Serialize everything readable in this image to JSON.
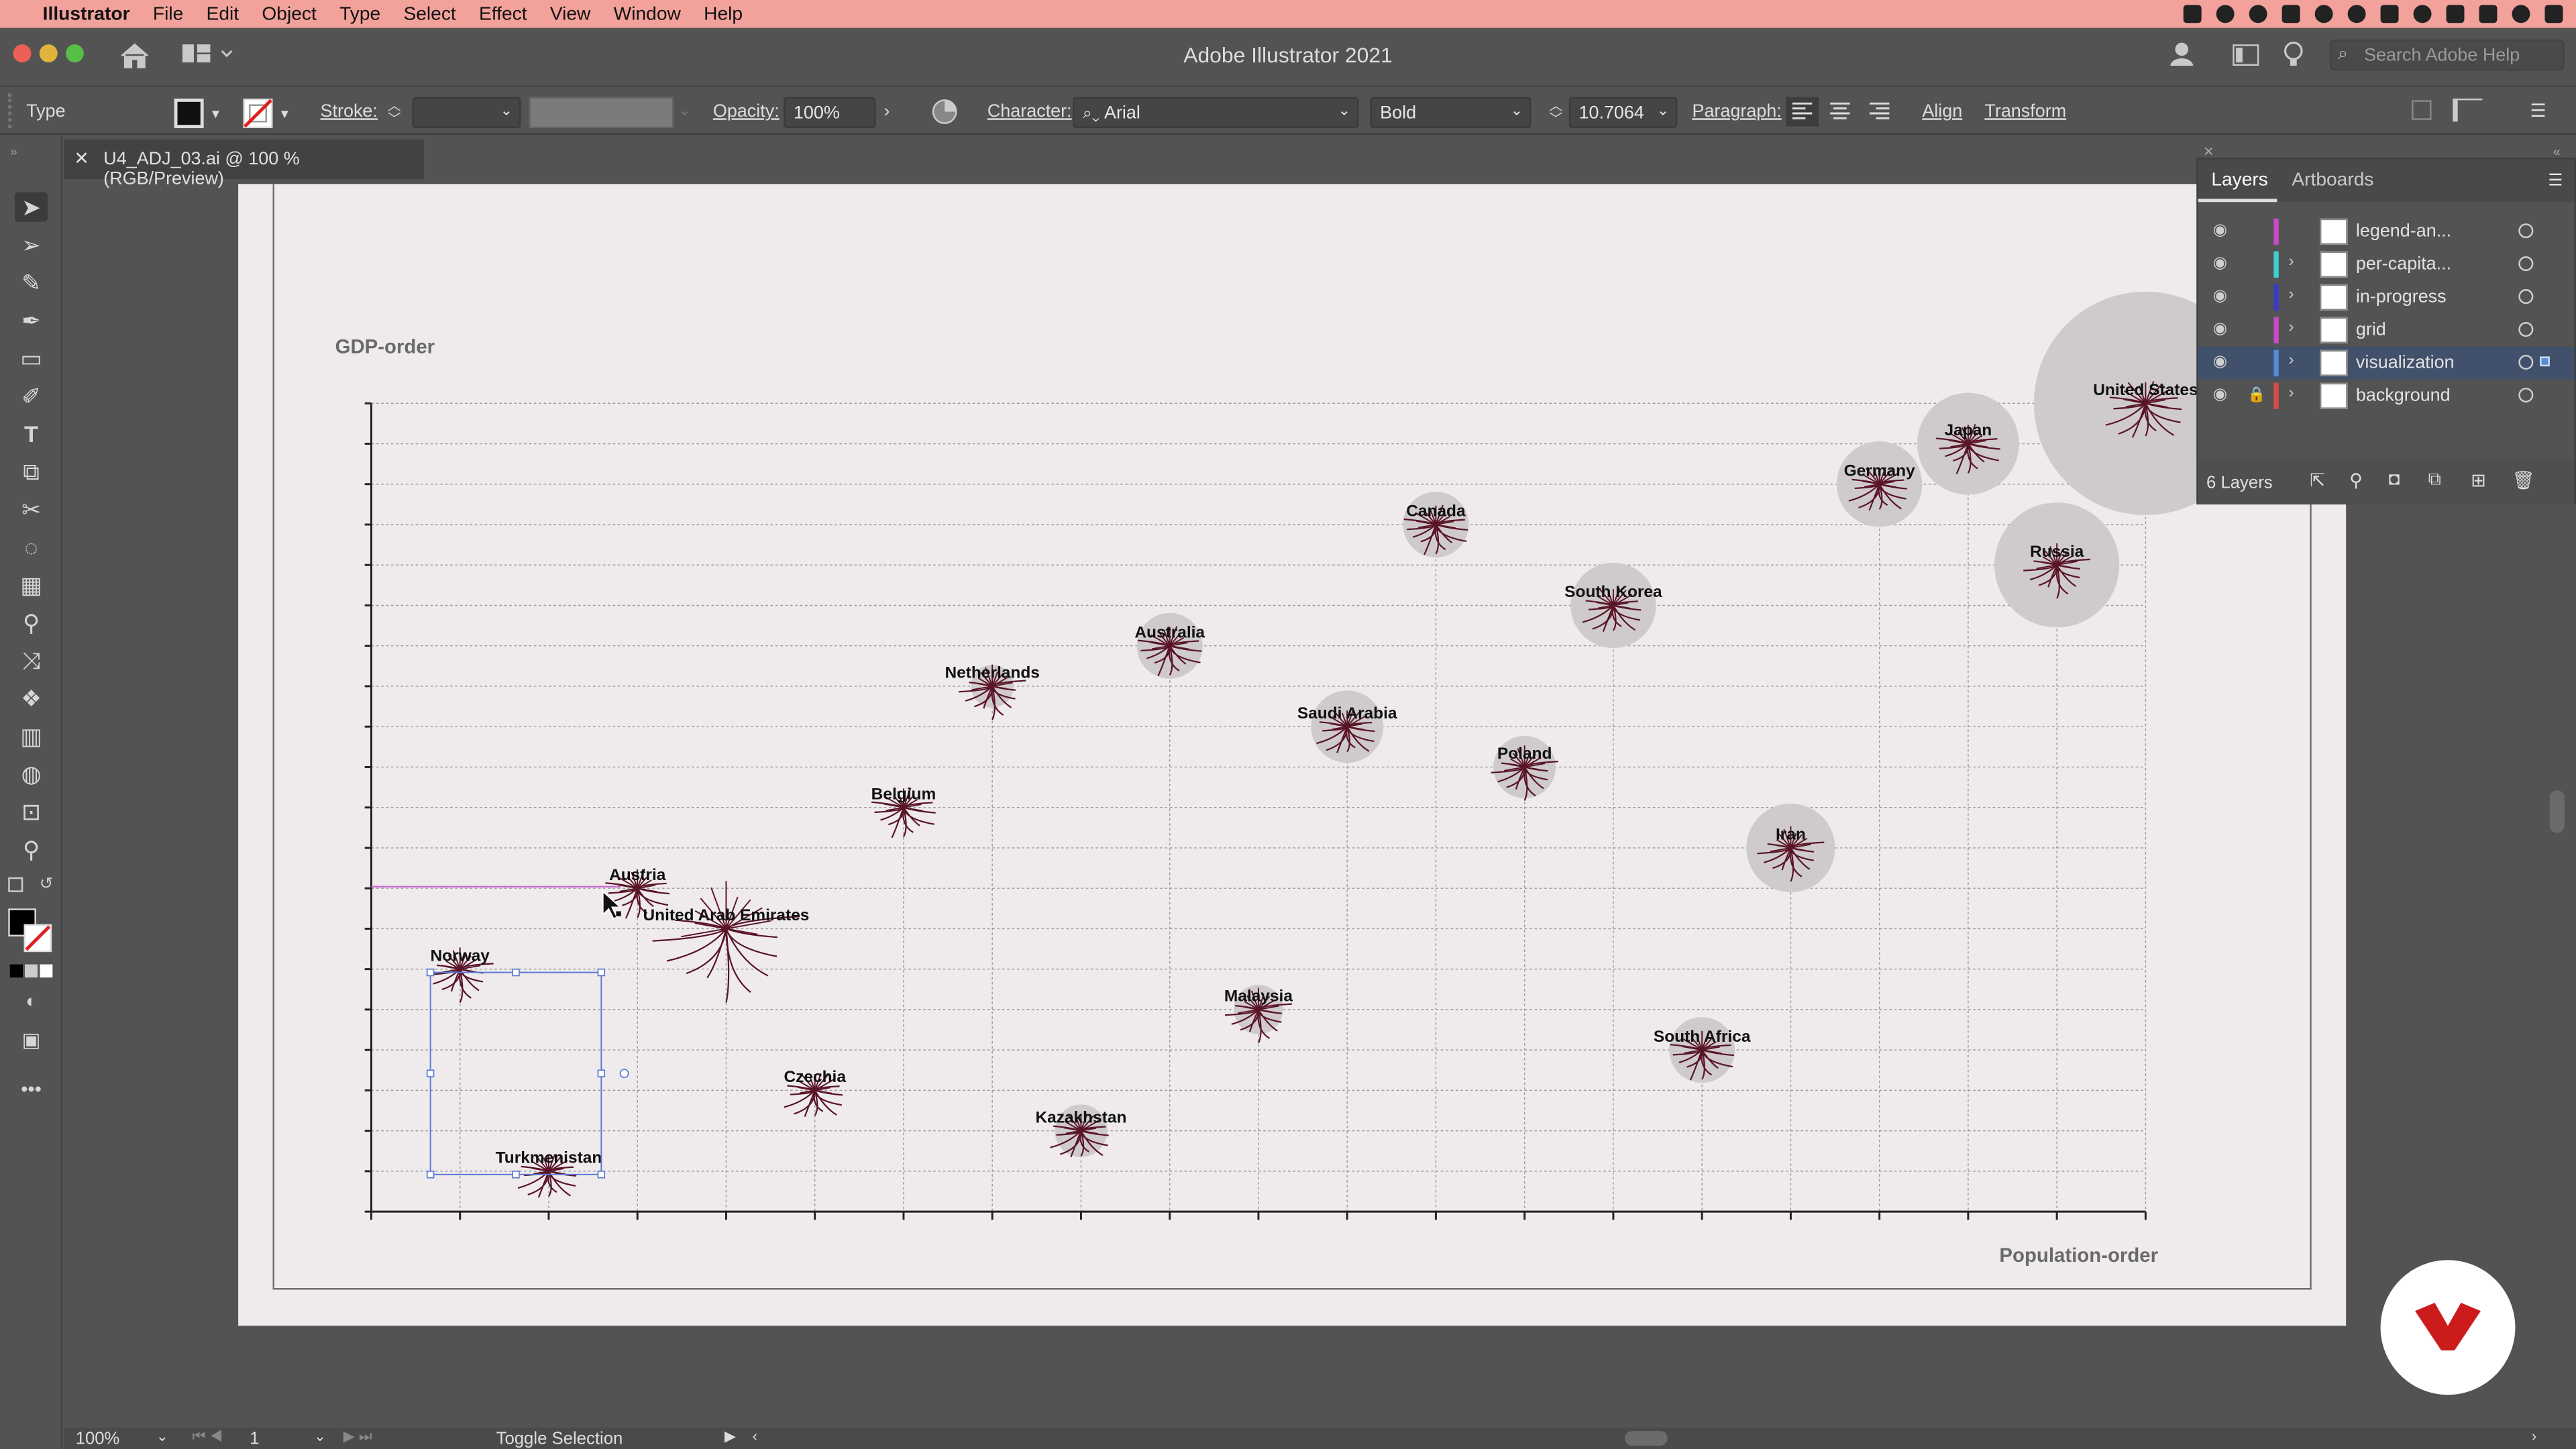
{
  "menubar": {
    "app": "Illustrator",
    "items": [
      "File",
      "Edit",
      "Object",
      "Type",
      "Select",
      "Effect",
      "View",
      "Window",
      "Help"
    ]
  },
  "window": {
    "title": "Adobe Illustrator 2021",
    "search_placeholder": "Search Adobe Help"
  },
  "control_bar": {
    "type_label": "Type",
    "stroke_label": "Stroke:",
    "opacity_label": "Opacity:",
    "opacity_value": "100%",
    "character_label": "Character:",
    "font_family": "Arial",
    "font_style": "Bold",
    "font_size": "10.7064",
    "paragraph_label": "Paragraph:",
    "align_label": "Align",
    "transform_label": "Transform"
  },
  "document_tab": {
    "title": "U4_ADJ_03.ai @ 100 % (RGB/Preview)"
  },
  "chart_data": {
    "type": "scatter",
    "title": "",
    "ylabel": "GDP-order",
    "xlabel": "Population-order",
    "x_ticks": 21,
    "y_ticks": 21,
    "points": [
      {
        "name": "Norway",
        "x": 1,
        "y": 6,
        "circle": 0
      },
      {
        "name": "Turkmenistan",
        "x": 2,
        "y": 1,
        "circle": 0
      },
      {
        "name": "Austria",
        "x": 3,
        "y": 8,
        "circle": 0
      },
      {
        "name": "United Arab Emirates",
        "x": 4,
        "y": 7,
        "circle": 0
      },
      {
        "name": "Czechia",
        "x": 5,
        "y": 3,
        "circle": 0
      },
      {
        "name": "Belgium",
        "x": 6,
        "y": 10,
        "circle": 0
      },
      {
        "name": "Netherlands",
        "x": 7,
        "y": 13,
        "circle": 13
      },
      {
        "name": "Kazakhstan",
        "x": 8,
        "y": 2,
        "circle": 16
      },
      {
        "name": "Australia",
        "x": 9,
        "y": 14,
        "circle": 20
      },
      {
        "name": "Malaysia",
        "x": 10,
        "y": 5,
        "circle": 15
      },
      {
        "name": "Saudi Arabia",
        "x": 11,
        "y": 12,
        "circle": 22
      },
      {
        "name": "Canada",
        "x": 12,
        "y": 17,
        "circle": 20
      },
      {
        "name": "Poland",
        "x": 13,
        "y": 11,
        "circle": 19
      },
      {
        "name": "South Korea",
        "x": 14,
        "y": 15,
        "circle": 26
      },
      {
        "name": "South Africa",
        "x": 15,
        "y": 4,
        "circle": 20
      },
      {
        "name": "Iran",
        "x": 16,
        "y": 9,
        "circle": 27
      },
      {
        "name": "Germany",
        "x": 17,
        "y": 18,
        "circle": 26
      },
      {
        "name": "Japan",
        "x": 18,
        "y": 19,
        "circle": 31
      },
      {
        "name": "Russia",
        "x": 19,
        "y": 16,
        "circle": 38
      },
      {
        "name": "United States",
        "x": 20,
        "y": 20,
        "circle": 68
      }
    ]
  },
  "layers_panel": {
    "tab_layers": "Layers",
    "tab_artboards": "Artboards",
    "layers": [
      {
        "name": "legend-an...",
        "color": "#c84ac8",
        "expandable": false,
        "locked": false,
        "selected": false
      },
      {
        "name": "per-capita...",
        "color": "#3fcfcf",
        "expandable": true,
        "locked": false,
        "selected": false
      },
      {
        "name": "in-progress",
        "color": "#3a3ac8",
        "expandable": true,
        "locked": false,
        "selected": false
      },
      {
        "name": "grid",
        "color": "#c84ac8",
        "expandable": true,
        "locked": false,
        "selected": false
      },
      {
        "name": "visualization",
        "color": "#5b8ad6",
        "expandable": true,
        "locked": false,
        "selected": true
      },
      {
        "name": "background",
        "color": "#d64a4a",
        "expandable": true,
        "locked": true,
        "selected": false
      }
    ],
    "count_label": "6 Layers"
  },
  "statusbar": {
    "zoom": "100%",
    "artboard_number": "1",
    "status_text": "Toggle Selection"
  },
  "colors": {
    "menubar": "#f2a29b",
    "artboard": "#efebec",
    "glyph": "#5a1428",
    "circle": "#cfcbcc",
    "selection": "#5b7ad6",
    "badge_mark": "#cc1b1b"
  }
}
